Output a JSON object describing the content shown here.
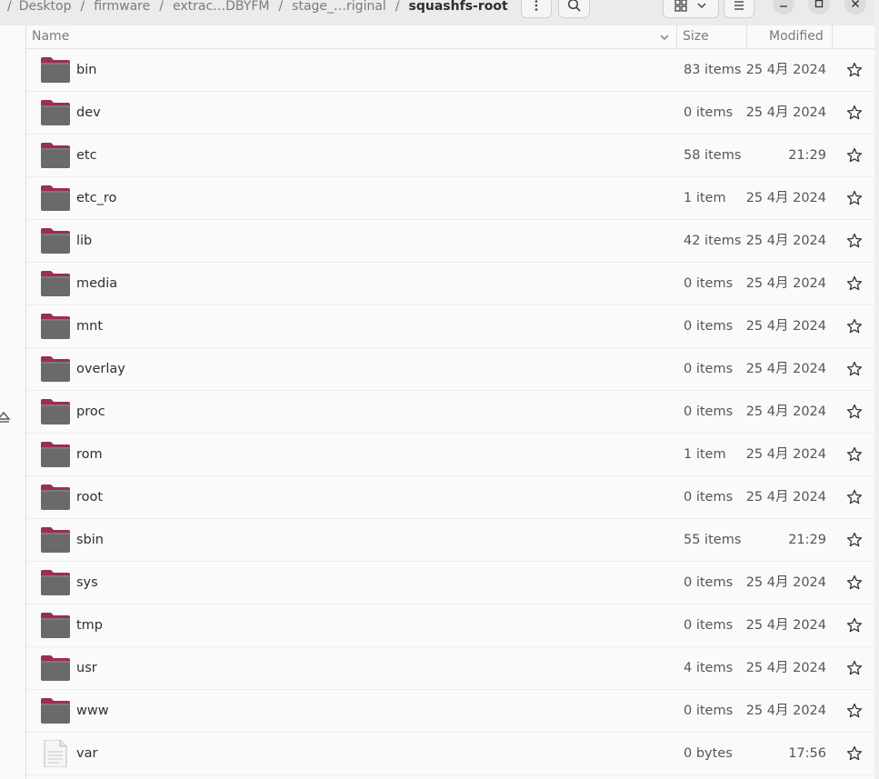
{
  "breadcrumb": [
    "Desktop",
    "firmware",
    "extrac…DBYFM",
    "stage_…riginal",
    "squashfs-root"
  ],
  "columns": {
    "name": "Name",
    "size": "Size",
    "modified": "Modified"
  },
  "files": [
    {
      "name": "bin",
      "size": "83 items",
      "modified": "25 4月 2024",
      "type": "folder"
    },
    {
      "name": "dev",
      "size": "0 items",
      "modified": "25 4月 2024",
      "type": "folder"
    },
    {
      "name": "etc",
      "size": "58 items",
      "modified": "21:29",
      "type": "folder"
    },
    {
      "name": "etc_ro",
      "size": "1 item",
      "modified": "25 4月 2024",
      "type": "folder"
    },
    {
      "name": "lib",
      "size": "42 items",
      "modified": "25 4月 2024",
      "type": "folder"
    },
    {
      "name": "media",
      "size": "0 items",
      "modified": "25 4月 2024",
      "type": "folder"
    },
    {
      "name": "mnt",
      "size": "0 items",
      "modified": "25 4月 2024",
      "type": "folder"
    },
    {
      "name": "overlay",
      "size": "0 items",
      "modified": "25 4月 2024",
      "type": "folder"
    },
    {
      "name": "proc",
      "size": "0 items",
      "modified": "25 4月 2024",
      "type": "folder"
    },
    {
      "name": "rom",
      "size": "1 item",
      "modified": "25 4月 2024",
      "type": "folder"
    },
    {
      "name": "root",
      "size": "0 items",
      "modified": "25 4月 2024",
      "type": "folder"
    },
    {
      "name": "sbin",
      "size": "55 items",
      "modified": "21:29",
      "type": "folder"
    },
    {
      "name": "sys",
      "size": "0 items",
      "modified": "25 4月 2024",
      "type": "folder"
    },
    {
      "name": "tmp",
      "size": "0 items",
      "modified": "25 4月 2024",
      "type": "folder"
    },
    {
      "name": "usr",
      "size": "4 items",
      "modified": "25 4月 2024",
      "type": "folder"
    },
    {
      "name": "www",
      "size": "0 items",
      "modified": "25 4月 2024",
      "type": "folder"
    },
    {
      "name": "var",
      "size": "0 bytes",
      "modified": "17:56",
      "type": "file"
    }
  ],
  "icons": {
    "folder": "folder-icon",
    "file": "text-file-icon",
    "star": "star-icon",
    "search": "search-icon",
    "menu": "kebab-menu-icon",
    "grid": "grid-view-icon",
    "chevron": "chevron-down-icon",
    "list": "list-menu-icon",
    "minimize": "minimize-icon",
    "maximize": "maximize-icon",
    "close": "close-icon",
    "eject": "eject-icon"
  },
  "colors": {
    "folder_tab": "#9a2f4e",
    "folder_body": "#6a6a6a",
    "accent": "#e95420"
  }
}
